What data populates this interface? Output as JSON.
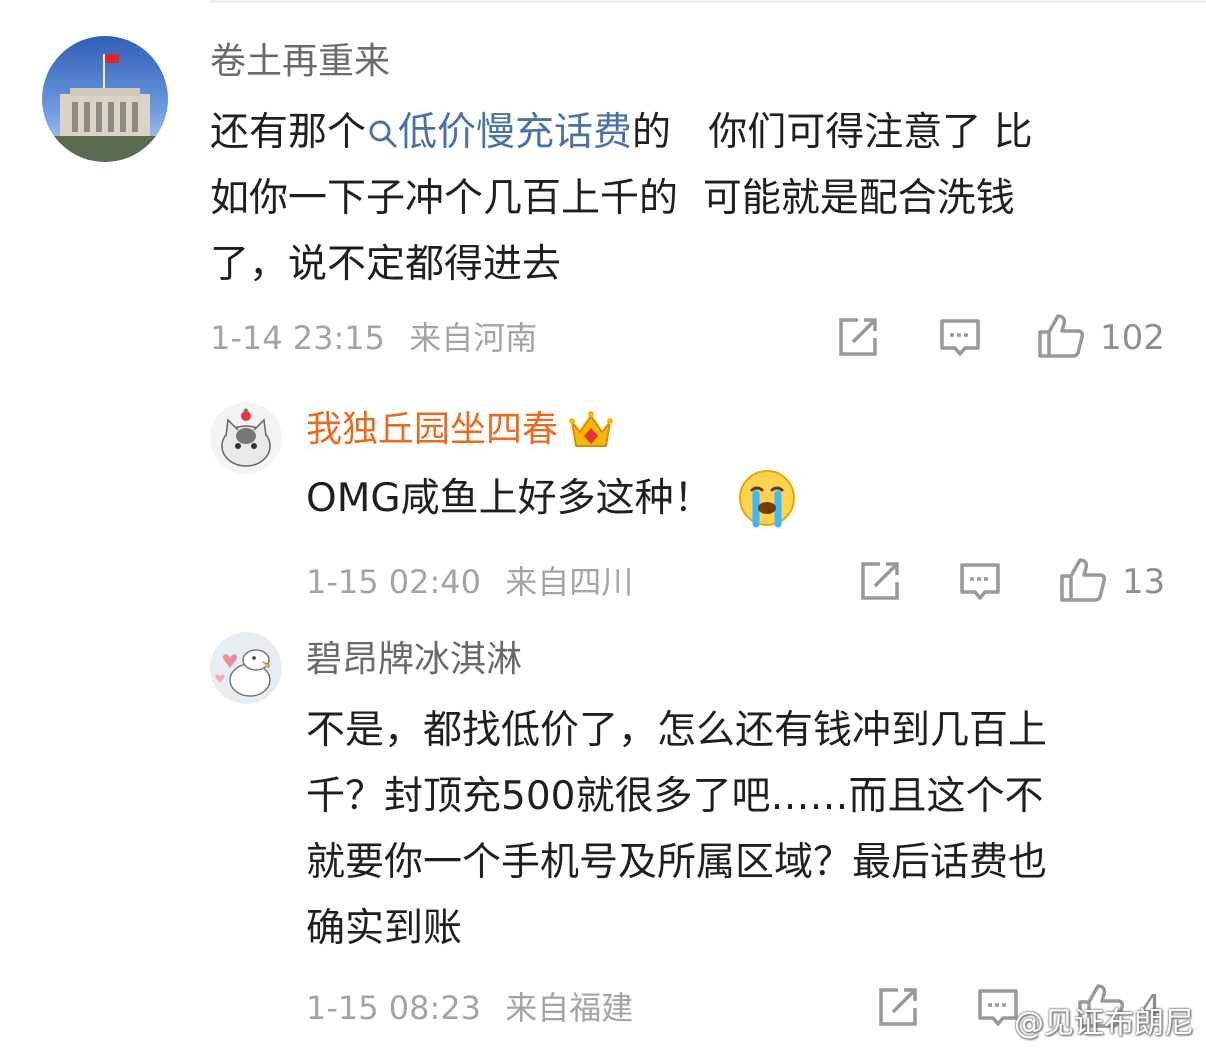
{
  "comments": [
    {
      "username": "卷土再重来",
      "body_lines": [
        {
          "pre": "还有那个",
          "tag": "低价慢充话费",
          "post": "的   你们可得注意了 比"
        },
        {
          "text": "如你一下子冲个几百上千的  可能就是配合洗钱"
        },
        {
          "text": "了，说不定都得进去"
        }
      ],
      "time": "1-14 23:15",
      "location": "来自河南",
      "likes": "102"
    },
    {
      "username": "我独丘园坐四春",
      "body": "OMG咸鱼上好多这种！",
      "time": "1-15 02:40",
      "location": "来自四川",
      "likes": "13"
    },
    {
      "username": "碧昂牌冰淇淋",
      "body_lines": [
        "不是，都找低价了，怎么还有钱冲到几百上",
        "千？封顶充500就很多了吧……而且这个不",
        "就要你一个手机号及所属区域？最后话费也",
        "确实到账"
      ],
      "time": "1-15 08:23",
      "location": "来自福建",
      "likes": "4"
    }
  ],
  "watermark": "@见证布朗尼",
  "colors": {
    "link": "#4a71a8",
    "vip_name": "#ea6a1f",
    "meta": "#a4a4a4"
  },
  "icons": [
    "search-icon",
    "repost-icon",
    "comment-icon",
    "like-icon",
    "crown-icon",
    "crying-emoji"
  ]
}
